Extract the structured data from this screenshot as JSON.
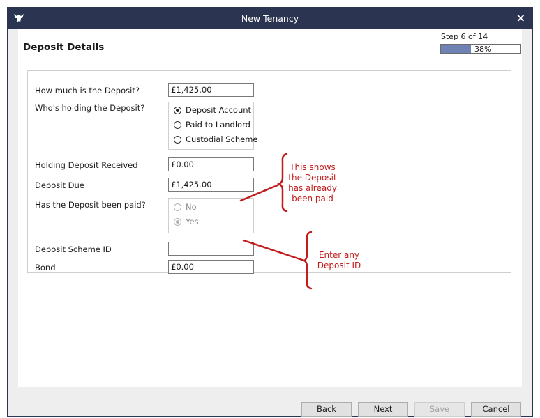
{
  "window": {
    "title": "New Tenancy",
    "close_symbol": "×"
  },
  "header": {
    "title": "Deposit Details",
    "step": "Step 6 of 14",
    "progress_percent_label": "38%",
    "progress_value": 0.38
  },
  "form": {
    "deposit_amount": {
      "label": "How much is the Deposit?",
      "value": "£1,425.00"
    },
    "holder": {
      "label": "Who's holding the Deposit?",
      "options": [
        "Deposit Account",
        "Paid to Landlord",
        "Custodial Scheme"
      ],
      "selected": "Deposit Account"
    },
    "holding_deposit": {
      "label": "Holding Deposit Received",
      "value": "£0.00"
    },
    "deposit_due": {
      "label": "Deposit Due",
      "value": "£1,425.00"
    },
    "paid": {
      "label": "Has the Deposit been paid?",
      "options": [
        "No",
        "Yes"
      ],
      "selected": "Yes"
    },
    "scheme_id": {
      "label": "Deposit Scheme ID",
      "value": ""
    },
    "bond": {
      "label": "Bond",
      "value": "£0.00"
    }
  },
  "annotations": {
    "paid_note": [
      "This shows",
      "the Deposit",
      "has already",
      "been paid"
    ],
    "id_note": [
      "Enter any",
      "Deposit ID"
    ],
    "color": "#c21c1c"
  },
  "buttons": {
    "back": "Back",
    "next": "Next",
    "save": "Save",
    "cancel": "Cancel"
  },
  "colors": {
    "titlebar": "#2b3551",
    "progress_fill": "#6e83b4"
  }
}
